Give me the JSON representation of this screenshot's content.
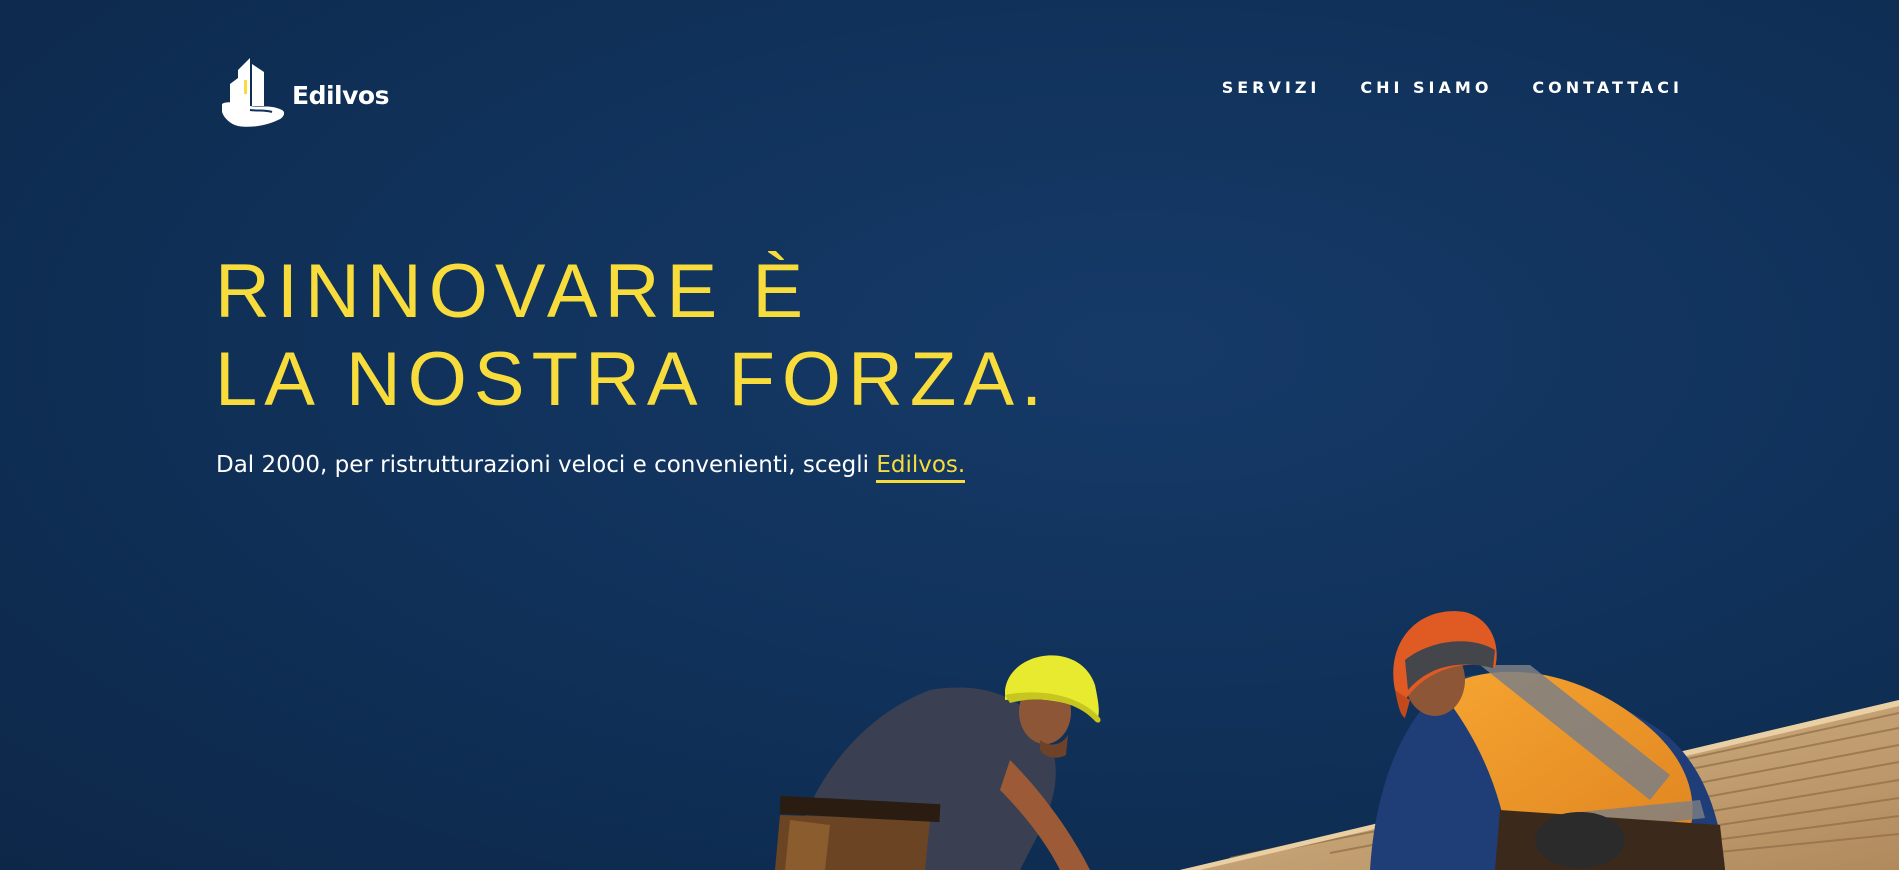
{
  "brand": {
    "name": "Edilvos",
    "logo_icon": "building-hand-icon"
  },
  "nav": {
    "items": [
      {
        "label": "SERVIZI"
      },
      {
        "label": "CHI SIAMO"
      },
      {
        "label": "CONTATTACI"
      }
    ]
  },
  "hero": {
    "title_line1": "RINNOVARE È",
    "title_line2": "LA NOSTRA FORZA.",
    "subtitle": "Dal 2000, per ristrutturazioni veloci e convenienti, scegli ",
    "subtitle_brand": "Edilvos."
  },
  "colors": {
    "background": "#10325b",
    "accent": "#f7dc3b",
    "text": "#ffffff"
  },
  "image": {
    "subject": "workers-on-roof-photo"
  }
}
